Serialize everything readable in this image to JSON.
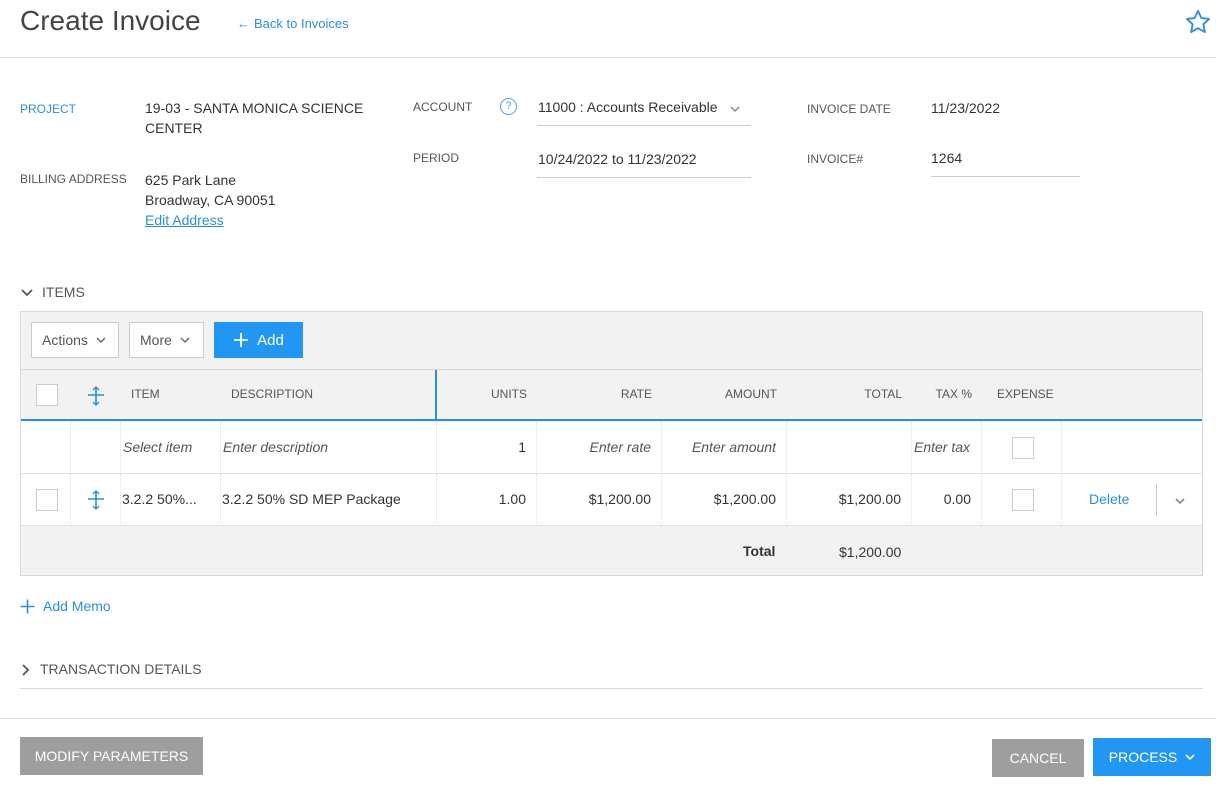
{
  "header": {
    "title": "Create Invoice",
    "back_link": "Back to Invoices",
    "back_arrow": "←"
  },
  "form": {
    "project_label": "PROJECT",
    "project_value_line1": "19-03 - SANTA MONICA SCIENCE",
    "project_value_line2": "CENTER",
    "billing_label": "BILLING ADDRESS",
    "billing_line1": "625 Park Lane",
    "billing_line2": "Broadway, CA 90051",
    "edit_address": "Edit Address",
    "account_label": "ACCOUNT",
    "account_help": "?",
    "account_value": "11000 : Accounts Receivable",
    "period_label": "PERIOD",
    "period_value": "10/24/2022 to 11/23/2022",
    "invoice_date_label": "INVOICE DATE",
    "invoice_date_value": "11/23/2022",
    "invoice_num_label": "INVOICE#",
    "invoice_num_value": "1264"
  },
  "items": {
    "section_label": "ITEMS",
    "toolbar": {
      "actions_label": "Actions",
      "more_label": "More",
      "add_label": "Add"
    },
    "columns": {
      "item": "ITEM",
      "description": "DESCRIPTION",
      "units": "UNITS",
      "rate": "RATE",
      "amount": "AMOUNT",
      "total": "TOTAL",
      "tax": "TAX %",
      "expense": "EXPENSE"
    },
    "new_row": {
      "item_placeholder": "Select item",
      "description_placeholder": "Enter description",
      "units": "1",
      "rate_placeholder": "Enter rate",
      "amount_placeholder": "Enter amount",
      "tax_placeholder": "Enter tax"
    },
    "rows": [
      {
        "item": "3.2.2 50%...",
        "description": "3.2.2 50% SD MEP Package",
        "units": "1.00",
        "rate": "$1,200.00",
        "amount": "$1,200.00",
        "total": "$1,200.00",
        "tax": "0.00",
        "delete_label": "Delete"
      }
    ],
    "total_label": "Total",
    "total_value": "$1,200.00"
  },
  "add_memo": "Add Memo",
  "transaction_details": "TRANSACTION DETAILS",
  "footer": {
    "modify_parameters": "MODIFY PARAMETERS",
    "cancel": "CANCEL",
    "process": "PROCESS"
  },
  "colors": {
    "accent": "#2196f3",
    "link": "#2b8fd8",
    "gray_button": "#9e9e9e"
  },
  "icons": [
    "star-icon",
    "help-icon",
    "chevron-down-icon",
    "plus-icon",
    "drag-handle-icon",
    "chevron-right-icon"
  ]
}
